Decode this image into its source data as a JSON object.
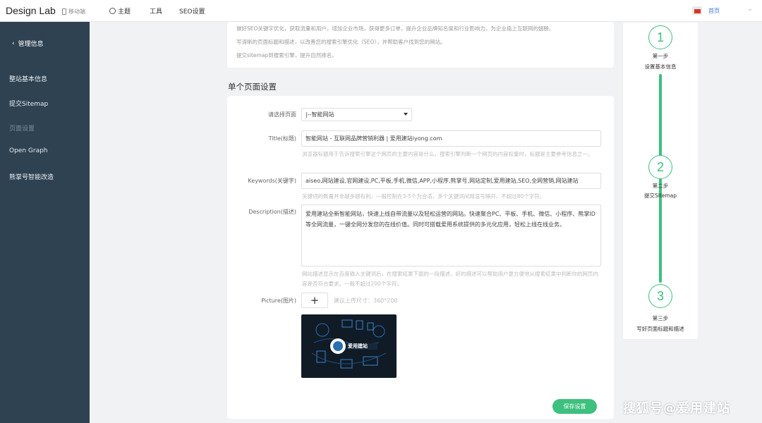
{
  "topbar": {
    "brand": "Design Lab",
    "mobile": "移动端",
    "nav": [
      {
        "label": "主题"
      },
      {
        "label": "工具"
      },
      {
        "label": "SEO设置"
      }
    ],
    "home": "首页"
  },
  "sidebar": {
    "back": "管理信息",
    "items": [
      {
        "label": "整站基本信息"
      },
      {
        "label": "提交Sitemap"
      },
      {
        "label": "页面设置"
      },
      {
        "label": "Open Graph"
      },
      {
        "label": "熊掌号智能改造"
      }
    ]
  },
  "intro": {
    "lines": [
      "做好SEO关键字优化，获取流量和用户，增加企业市场，获得更多订单，提升企业品牌知名度和行业影响力，为企业插上互联网的翅膀。",
      "写清晰的页面标题和描述，以改善您的搜索引擎优化（SEO），并帮助客户找到您的网站。",
      "提交sitemap到搜索引擎，提升自然排名。"
    ]
  },
  "section_title": "单个页面设置",
  "form": {
    "page_label": "请选择页面",
    "page_value": "|--智能网站",
    "title_label": "Title(标题)",
    "title_value": "智能网站 - 互联网品牌营销利器 | 爱用建站iyong.com",
    "title_hint": "浏览器标题用于告诉搜索引擎这个网页的主要内容是什么，搜索引擎判断一个网页的内容权重时，标题是主要参考信息之一。",
    "keywords_label": "Keywords(关键字)",
    "keywords_value": "aiseo,网站建设,官网建设,PC,平板,手机,微信,APP,小程序,熊掌号,网站定制,爱用建站,SEO,全网营销,网站建站",
    "keywords_hint": "关键词的数量并非越多越有利，一般控制在3-5个为合适，多个关键词间用逗号隔开，不超过80个字符。",
    "desc_label": "Description(描述)",
    "desc_value": "爱用建站全新智能网站，快速上线自带流量以及轻松运营的网站。快速聚合PC、平板、手机、微信、小程序、熊掌ID等全网流量，一键全网分发您的在线价值。同时可搭载爱用系统提供的多元化应用，轻松上线在线业务。",
    "desc_hint": "网站描述显示在百度输入关键词后，在搜索结果下面的一段描述，好的描述可以帮助用户更方便地从搜索结果中判断你的网页内容是否符合要求。一般不超过200个字符。",
    "picture_label": "Picture(图片)",
    "upload_plus": "+",
    "upload_tip": "建议上传尺寸：360*200",
    "preview_brand": "爱用建站",
    "save": "保存设置"
  },
  "steps": [
    {
      "num": "1",
      "step": "第一步",
      "text": "设置基本信息"
    },
    {
      "num": "2",
      "step": "第二步",
      "text": "提交Sitemap"
    },
    {
      "num": "3",
      "step": "第三步",
      "text": "写好页面标题和描述"
    }
  ],
  "watermark": "搜狐号@爱用建站",
  "colors": {
    "accent": "#3ec07e",
    "sidebar": "#2f4252",
    "link": "#3a7bd5"
  }
}
